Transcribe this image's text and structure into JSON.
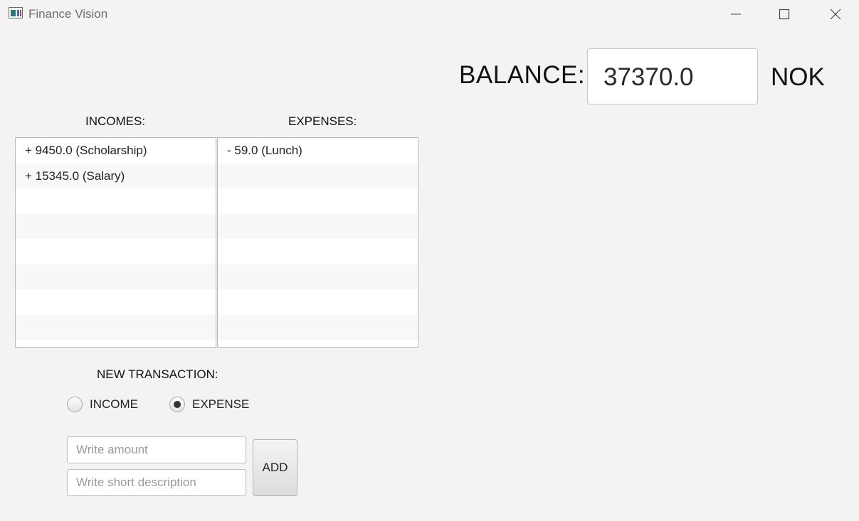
{
  "window": {
    "title": "Finance Vision"
  },
  "balance": {
    "label": "BALANCE:",
    "value": "37370.0",
    "currency": "NOK"
  },
  "incomes": {
    "label": "INCOMES:",
    "items": [
      "+ 9450.0 (Scholarship)",
      "+ 15345.0 (Salary)",
      "",
      "",
      "",
      "",
      "",
      ""
    ]
  },
  "expenses": {
    "label": "EXPENSES:",
    "items": [
      "- 59.0 (Lunch)",
      "",
      "",
      "",
      "",
      "",
      "",
      ""
    ]
  },
  "new_transaction": {
    "label": "NEW TRANSACTION:",
    "type_options": [
      {
        "label": "INCOME",
        "selected": false
      },
      {
        "label": "EXPENSE",
        "selected": true
      }
    ],
    "amount_placeholder": "Write amount",
    "amount_value": "",
    "description_placeholder": "Write short description",
    "description_value": "",
    "add_label": "ADD"
  }
}
